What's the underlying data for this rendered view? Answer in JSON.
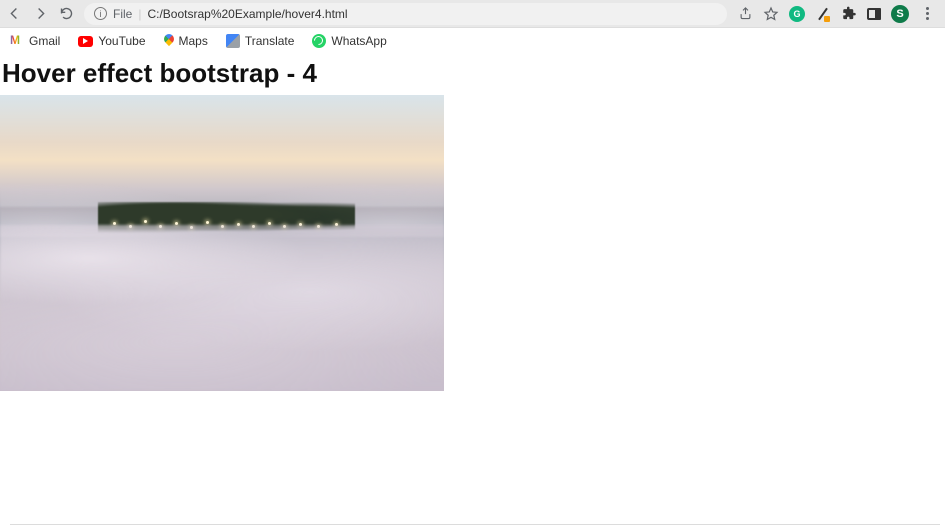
{
  "address": {
    "file_label": "File",
    "url": "C:/Bootsrap%20Example/hover4.html"
  },
  "avatar": {
    "initial": "S"
  },
  "bookmarks": {
    "gmail": "Gmail",
    "youtube": "YouTube",
    "maps": "Maps",
    "translate": "Translate",
    "whatsapp": "WhatsApp"
  },
  "page": {
    "heading": "Hover effect bootstrap - 4"
  }
}
